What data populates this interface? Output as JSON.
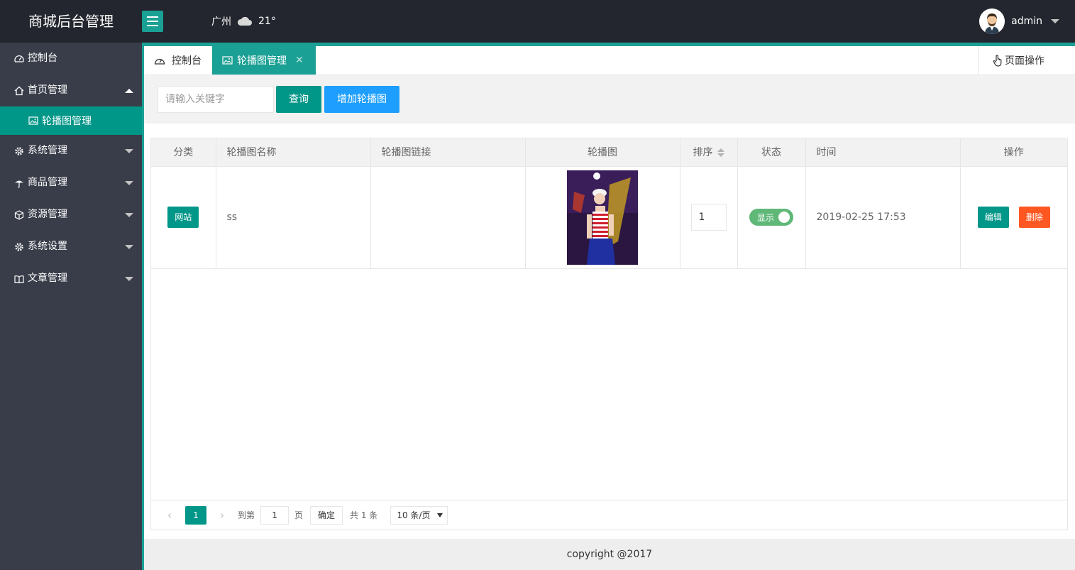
{
  "header": {
    "app_title": "商城后台管理",
    "weather_city": "广州",
    "weather_temp": "21°",
    "username": "admin"
  },
  "sidebar": {
    "items": [
      {
        "label": "控制台",
        "icon": "dashboard-icon"
      },
      {
        "label": "首页管理",
        "icon": "home-icon",
        "expanded": true
      },
      {
        "label": "轮播图管理",
        "icon": "image-icon",
        "active": true
      },
      {
        "label": "系统管理",
        "icon": "gear-icon"
      },
      {
        "label": "商品管理",
        "icon": "umbrella-icon"
      },
      {
        "label": "资源管理",
        "icon": "cube-icon"
      },
      {
        "label": "系统设置",
        "icon": "gear-icon"
      },
      {
        "label": "文章管理",
        "icon": "book-icon"
      }
    ]
  },
  "tabs": {
    "home": "控制台",
    "active": "轮播图管理",
    "close": "✕",
    "page_ops": "页面操作"
  },
  "toolbar": {
    "search_placeholder": "请输入关键字",
    "query_label": "查询",
    "add_label": "增加轮播图"
  },
  "table": {
    "columns": [
      "分类",
      "轮播图名称",
      "轮播图链接",
      "轮播图",
      "排序",
      "状态",
      "时间",
      "操作"
    ],
    "rows": [
      {
        "category": "网站",
        "name": "ss",
        "link": "",
        "order": "1",
        "status": "显示",
        "time": "2019-02-25 17:53",
        "edit": "编辑",
        "delete": "删除"
      }
    ]
  },
  "pager": {
    "current": "1",
    "goto_label": "到第",
    "goto_value": "1",
    "page_suffix": "页",
    "confirm": "确定",
    "total": "共 1 条",
    "page_size": "10 条/页"
  },
  "footer": {
    "copyright": "copyright @2017"
  },
  "colors": {
    "header_bg": "#23262e",
    "sidebar_bg": "#393d49",
    "accent": "#009688",
    "tab_accent": "#1aa094",
    "blue": "#1e9fff",
    "danger": "#ff5722",
    "switch_on": "#5fb878"
  }
}
